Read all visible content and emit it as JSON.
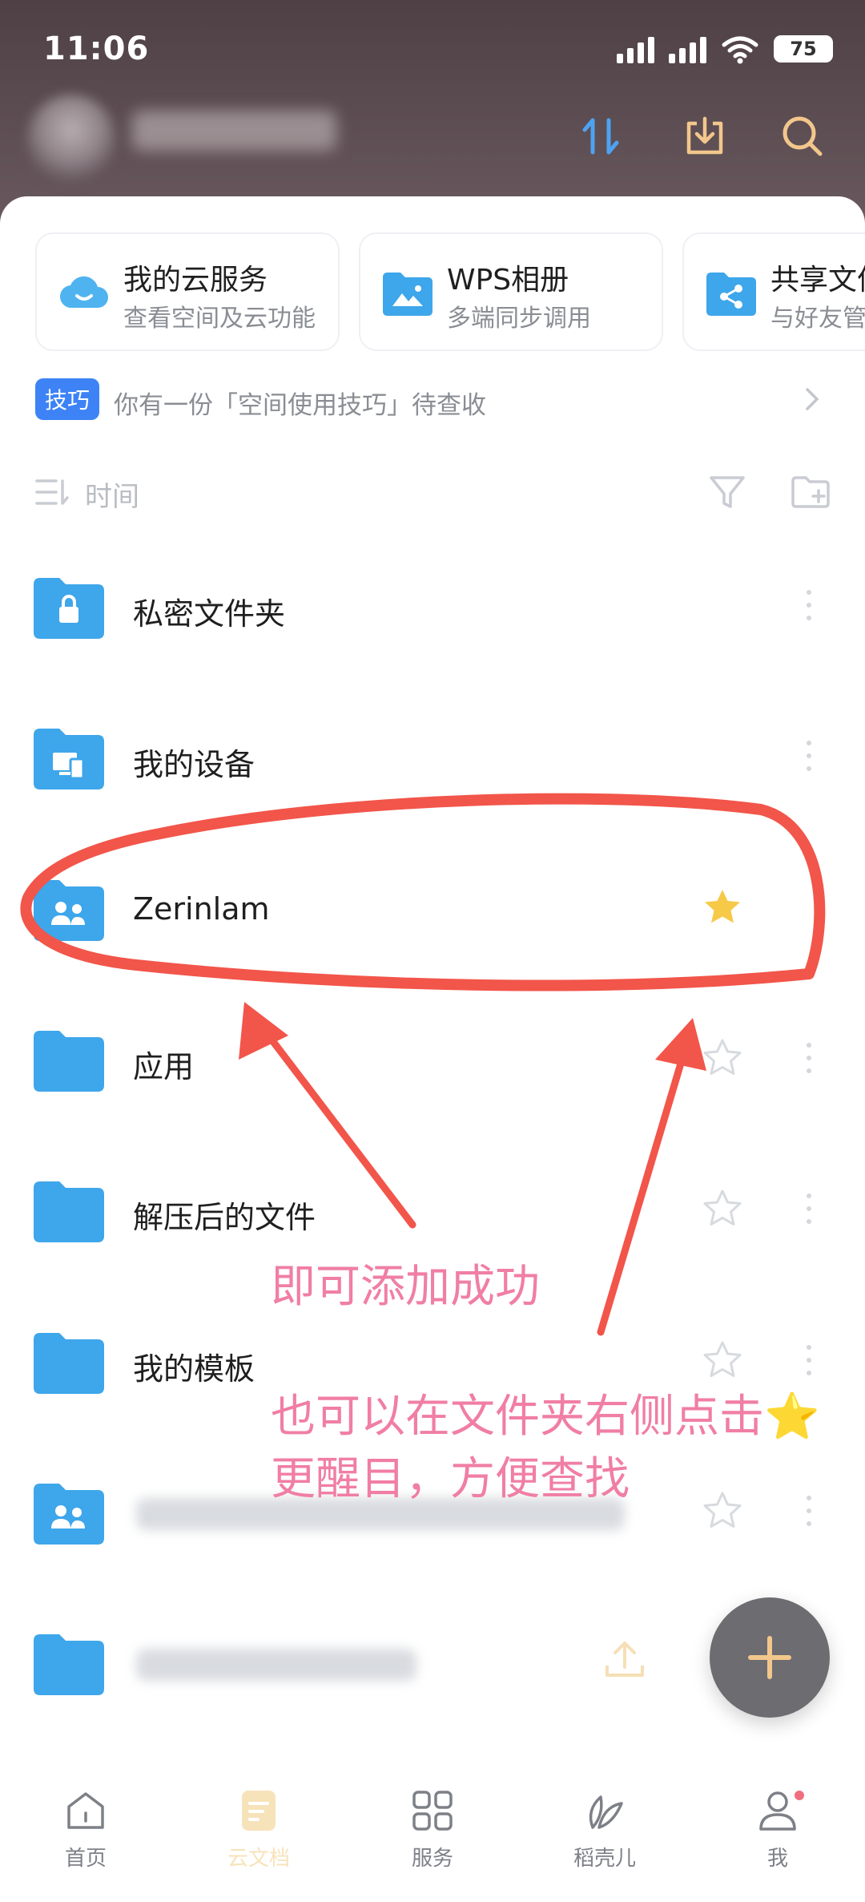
{
  "status_bar": {
    "time": "11:06",
    "battery": "75"
  },
  "cards": [
    {
      "title": "我的云服务",
      "subtitle": "查看空间及云功能",
      "icon": "cloud-icon"
    },
    {
      "title": "WPS相册",
      "subtitle": "多端同步调用",
      "icon": "photo-folder-icon"
    },
    {
      "title": "共享文件",
      "subtitle": "与好友管理",
      "icon": "share-folder-icon"
    }
  ],
  "tip": {
    "badge": "技巧",
    "text": "你有一份「空间使用技巧」待查收"
  },
  "sort": {
    "label": "时间"
  },
  "files": [
    {
      "name": "私密文件夹",
      "icon": "lock-folder-icon"
    },
    {
      "name": "我的设备",
      "icon": "device-folder-icon"
    },
    {
      "name": "Zerinlam",
      "icon": "shared-folder-icon",
      "starred": true
    },
    {
      "name": "应用",
      "icon": "folder-icon"
    },
    {
      "name": "解压后的文件",
      "icon": "folder-icon"
    },
    {
      "name": "我的模板",
      "icon": "folder-icon"
    }
  ],
  "annotations": {
    "arrow_text": "即可添加成功",
    "hint_line1": "也可以在文件夹右侧点击⭐",
    "hint_line2": "更醒目，方便查找"
  },
  "nav": [
    {
      "label": "首页",
      "icon": "home-icon"
    },
    {
      "label": "云文档",
      "icon": "cloud-doc-icon",
      "active": true
    },
    {
      "label": "服务",
      "icon": "grid-icon"
    },
    {
      "label": "稻壳儿",
      "icon": "leaf-icon"
    },
    {
      "label": "我",
      "icon": "person-icon"
    }
  ],
  "colors": {
    "accent_blue": "#3d83f6",
    "star_gold": "#f7c948",
    "fab": "#6c6c71",
    "annotation_red": "#f2554a",
    "annotation_pink": "#f07ea5"
  }
}
